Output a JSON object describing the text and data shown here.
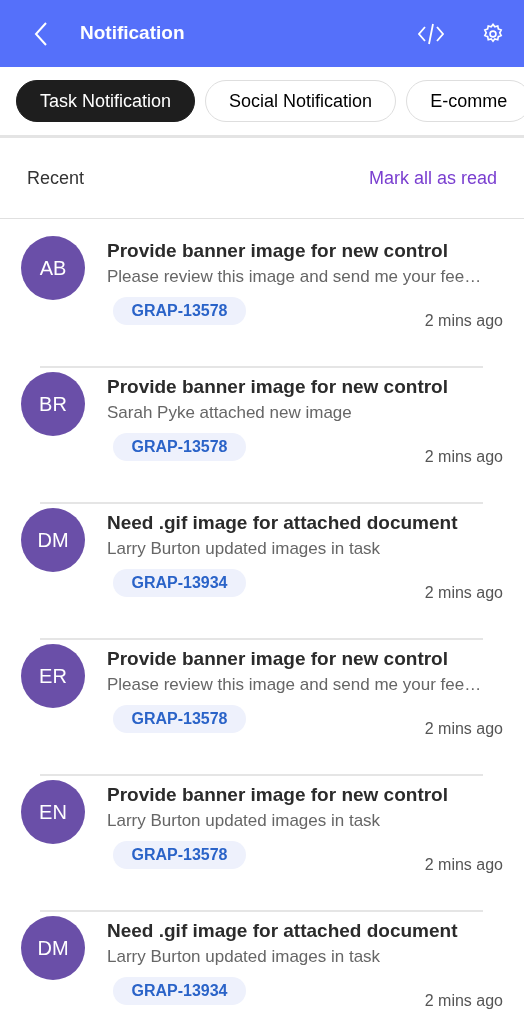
{
  "header": {
    "title": "Notification"
  },
  "tabs": [
    {
      "label": "Task Notification",
      "selected": true
    },
    {
      "label": "Social Notification",
      "selected": false
    },
    {
      "label": "E-comme",
      "selected": false
    }
  ],
  "section": {
    "title": "Recent",
    "action": "Mark all as read"
  },
  "notifications": [
    {
      "initials": "AB",
      "title": "Provide banner image for new control",
      "message": "Please review this image and send me your fee…",
      "tag": "GRAP-13578",
      "time": "2 mins ago"
    },
    {
      "initials": "BR",
      "title": "Provide banner image for new control",
      "message": "Sarah Pyke attached new image",
      "tag": "GRAP-13578",
      "time": "2 mins ago"
    },
    {
      "initials": "DM",
      "title": "Need .gif image for attached document",
      "message": "Larry Burton updated images in task",
      "tag": "GRAP-13934",
      "time": "2 mins ago"
    },
    {
      "initials": "ER",
      "title": "Provide banner image for new control",
      "message": "Please review this image and send me your fee…",
      "tag": "GRAP-13578",
      "time": "2 mins ago"
    },
    {
      "initials": "EN",
      "title": "Provide banner image for new control",
      "message": "Larry Burton updated images in task",
      "tag": "GRAP-13578",
      "time": "2 mins ago"
    },
    {
      "initials": "DM",
      "title": "Need .gif image for attached document",
      "message": "Larry Burton updated images in task",
      "tag": "GRAP-13934",
      "time": "2 mins ago"
    }
  ]
}
